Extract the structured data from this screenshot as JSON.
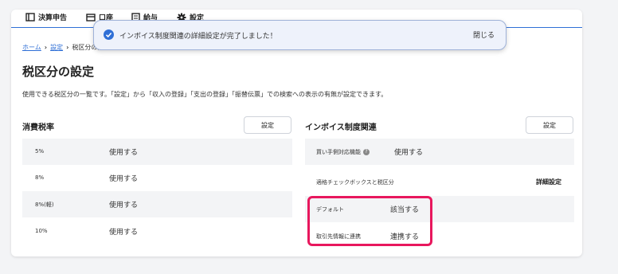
{
  "nav": {
    "items": [
      {
        "label": "決算申告",
        "icon": "ledger-icon"
      },
      {
        "label": "口座",
        "icon": "card-icon"
      },
      {
        "label": "給与",
        "icon": "document-icon"
      },
      {
        "label": "設定",
        "icon": "gear-icon"
      }
    ]
  },
  "toast": {
    "message": "インボイス制度関連の詳細設定が完了しました！",
    "close_label": "閉じる"
  },
  "breadcrumb": {
    "home": "ホーム",
    "settings": "設定",
    "current": "税区分の設定"
  },
  "page": {
    "title": "税区分の設定",
    "description": "使用できる税区分の一覧です。「設定」から「収入の登録」「支出の登録」「振替伝票」での検索への表示の有無が設定できます。"
  },
  "consumption_tax": {
    "title": "消費税率",
    "button": "設定",
    "rows": [
      {
        "rate": "5%",
        "status": "使用する"
      },
      {
        "rate": "8%",
        "status": "使用する"
      },
      {
        "rate": "8%(軽)",
        "status": "使用する"
      },
      {
        "rate": "10%",
        "status": "使用する"
      }
    ]
  },
  "invoice": {
    "title": "インボイス制度関連",
    "button": "設定",
    "purchase_label": "買い手側対応機能",
    "purchase_value": "使用する",
    "checkbox_label": "適格チェックボックスと税区分",
    "detail_link": "詳細設定",
    "rows": [
      {
        "label": "デフォルト",
        "value": "該当する"
      },
      {
        "label": "取引先情報に連携",
        "value": "連携する"
      }
    ]
  },
  "colors": {
    "accent": "#2f6fd6",
    "highlight": "#e8175d",
    "row_shade": "#f3f4f6"
  }
}
